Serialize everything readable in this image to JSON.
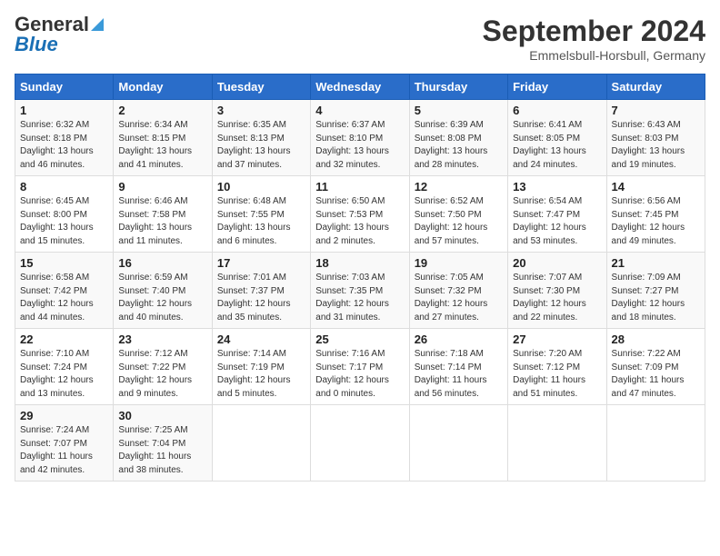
{
  "header": {
    "logo_general": "General",
    "logo_blue": "Blue",
    "month_title": "September 2024",
    "subtitle": "Emmelsbull-Horsbull, Germany"
  },
  "calendar": {
    "days_of_week": [
      "Sunday",
      "Monday",
      "Tuesday",
      "Wednesday",
      "Thursday",
      "Friday",
      "Saturday"
    ],
    "weeks": [
      [
        null,
        null,
        {
          "day": "1",
          "sunrise": "Sunrise: 6:32 AM",
          "sunset": "Sunset: 8:18 PM",
          "daylight": "Daylight: 13 hours and 46 minutes."
        },
        {
          "day": "2",
          "sunrise": "Sunrise: 6:34 AM",
          "sunset": "Sunset: 8:15 PM",
          "daylight": "Daylight: 13 hours and 41 minutes."
        },
        {
          "day": "3",
          "sunrise": "Sunrise: 6:35 AM",
          "sunset": "Sunset: 8:13 PM",
          "daylight": "Daylight: 13 hours and 37 minutes."
        },
        {
          "day": "4",
          "sunrise": "Sunrise: 6:37 AM",
          "sunset": "Sunset: 8:10 PM",
          "daylight": "Daylight: 13 hours and 32 minutes."
        },
        {
          "day": "5",
          "sunrise": "Sunrise: 6:39 AM",
          "sunset": "Sunset: 8:08 PM",
          "daylight": "Daylight: 13 hours and 28 minutes."
        },
        {
          "day": "6",
          "sunrise": "Sunrise: 6:41 AM",
          "sunset": "Sunset: 8:05 PM",
          "daylight": "Daylight: 13 hours and 24 minutes."
        },
        {
          "day": "7",
          "sunrise": "Sunrise: 6:43 AM",
          "sunset": "Sunset: 8:03 PM",
          "daylight": "Daylight: 13 hours and 19 minutes."
        }
      ],
      [
        {
          "day": "8",
          "sunrise": "Sunrise: 6:45 AM",
          "sunset": "Sunset: 8:00 PM",
          "daylight": "Daylight: 13 hours and 15 minutes."
        },
        {
          "day": "9",
          "sunrise": "Sunrise: 6:46 AM",
          "sunset": "Sunset: 7:58 PM",
          "daylight": "Daylight: 13 hours and 11 minutes."
        },
        {
          "day": "10",
          "sunrise": "Sunrise: 6:48 AM",
          "sunset": "Sunset: 7:55 PM",
          "daylight": "Daylight: 13 hours and 6 minutes."
        },
        {
          "day": "11",
          "sunrise": "Sunrise: 6:50 AM",
          "sunset": "Sunset: 7:53 PM",
          "daylight": "Daylight: 13 hours and 2 minutes."
        },
        {
          "day": "12",
          "sunrise": "Sunrise: 6:52 AM",
          "sunset": "Sunset: 7:50 PM",
          "daylight": "Daylight: 12 hours and 57 minutes."
        },
        {
          "day": "13",
          "sunrise": "Sunrise: 6:54 AM",
          "sunset": "Sunset: 7:47 PM",
          "daylight": "Daylight: 12 hours and 53 minutes."
        },
        {
          "day": "14",
          "sunrise": "Sunrise: 6:56 AM",
          "sunset": "Sunset: 7:45 PM",
          "daylight": "Daylight: 12 hours and 49 minutes."
        }
      ],
      [
        {
          "day": "15",
          "sunrise": "Sunrise: 6:58 AM",
          "sunset": "Sunset: 7:42 PM",
          "daylight": "Daylight: 12 hours and 44 minutes."
        },
        {
          "day": "16",
          "sunrise": "Sunrise: 6:59 AM",
          "sunset": "Sunset: 7:40 PM",
          "daylight": "Daylight: 12 hours and 40 minutes."
        },
        {
          "day": "17",
          "sunrise": "Sunrise: 7:01 AM",
          "sunset": "Sunset: 7:37 PM",
          "daylight": "Daylight: 12 hours and 35 minutes."
        },
        {
          "day": "18",
          "sunrise": "Sunrise: 7:03 AM",
          "sunset": "Sunset: 7:35 PM",
          "daylight": "Daylight: 12 hours and 31 minutes."
        },
        {
          "day": "19",
          "sunrise": "Sunrise: 7:05 AM",
          "sunset": "Sunset: 7:32 PM",
          "daylight": "Daylight: 12 hours and 27 minutes."
        },
        {
          "day": "20",
          "sunrise": "Sunrise: 7:07 AM",
          "sunset": "Sunset: 7:30 PM",
          "daylight": "Daylight: 12 hours and 22 minutes."
        },
        {
          "day": "21",
          "sunrise": "Sunrise: 7:09 AM",
          "sunset": "Sunset: 7:27 PM",
          "daylight": "Daylight: 12 hours and 18 minutes."
        }
      ],
      [
        {
          "day": "22",
          "sunrise": "Sunrise: 7:10 AM",
          "sunset": "Sunset: 7:24 PM",
          "daylight": "Daylight: 12 hours and 13 minutes."
        },
        {
          "day": "23",
          "sunrise": "Sunrise: 7:12 AM",
          "sunset": "Sunset: 7:22 PM",
          "daylight": "Daylight: 12 hours and 9 minutes."
        },
        {
          "day": "24",
          "sunrise": "Sunrise: 7:14 AM",
          "sunset": "Sunset: 7:19 PM",
          "daylight": "Daylight: 12 hours and 5 minutes."
        },
        {
          "day": "25",
          "sunrise": "Sunrise: 7:16 AM",
          "sunset": "Sunset: 7:17 PM",
          "daylight": "Daylight: 12 hours and 0 minutes."
        },
        {
          "day": "26",
          "sunrise": "Sunrise: 7:18 AM",
          "sunset": "Sunset: 7:14 PM",
          "daylight": "Daylight: 11 hours and 56 minutes."
        },
        {
          "day": "27",
          "sunrise": "Sunrise: 7:20 AM",
          "sunset": "Sunset: 7:12 PM",
          "daylight": "Daylight: 11 hours and 51 minutes."
        },
        {
          "day": "28",
          "sunrise": "Sunrise: 7:22 AM",
          "sunset": "Sunset: 7:09 PM",
          "daylight": "Daylight: 11 hours and 47 minutes."
        }
      ],
      [
        {
          "day": "29",
          "sunrise": "Sunrise: 7:24 AM",
          "sunset": "Sunset: 7:07 PM",
          "daylight": "Daylight: 11 hours and 42 minutes."
        },
        {
          "day": "30",
          "sunrise": "Sunrise: 7:25 AM",
          "sunset": "Sunset: 7:04 PM",
          "daylight": "Daylight: 11 hours and 38 minutes."
        },
        null,
        null,
        null,
        null,
        null
      ]
    ]
  }
}
